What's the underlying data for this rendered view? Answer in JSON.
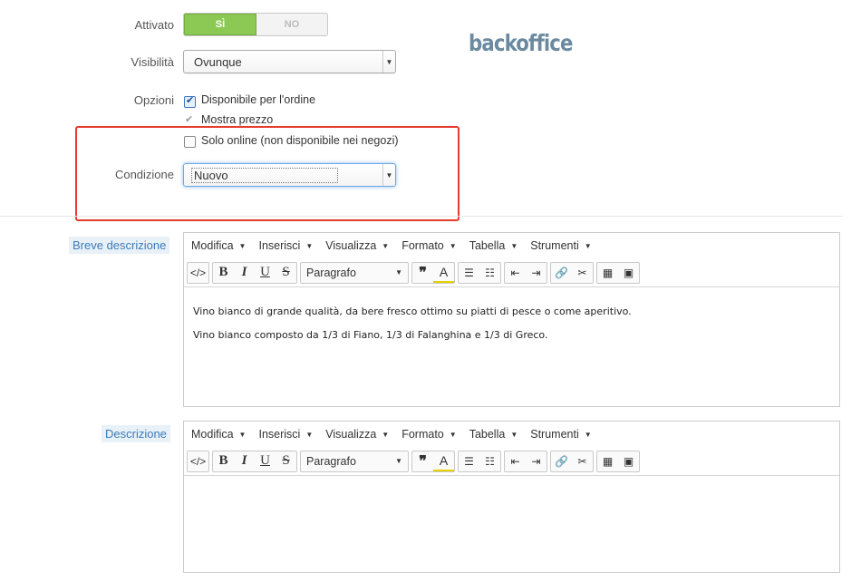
{
  "form": {
    "attivato_label": "Attivato",
    "toggle_yes": "SÌ",
    "toggle_no": "NO",
    "visibilita_label": "Visibilità",
    "visibilita_value": "Ovunque",
    "opzioni_label": "Opzioni",
    "options": [
      {
        "label": "Disponibile per l'ordine",
        "checked": true
      },
      {
        "label": "Mostra prezzo",
        "checked": true,
        "disabled": true
      },
      {
        "label": "Solo online (non disponibile nei negozi)",
        "checked": false
      }
    ],
    "condizione_label": "Condizione",
    "condizione_value": "Nuovo"
  },
  "logo": "backoffice",
  "highlight_color": "#e53b2f",
  "editors": {
    "menus": [
      "Modifica",
      "Inserisci",
      "Visualizza",
      "Formato",
      "Tabella",
      "Strumenti"
    ],
    "paragraph_select": "Paragrafo",
    "short": {
      "label": "Breve descrizione",
      "paragraphs": [
        "Vino bianco di grande qualità, da bere fresco ottimo su piatti di pesce o come aperitivo.",
        "Vino bianco  composto da 1/3 di Fiano, 1/3 di Falanghina e 1/3 di Greco."
      ]
    },
    "long": {
      "label": "Descrizione",
      "paragraphs": []
    }
  }
}
